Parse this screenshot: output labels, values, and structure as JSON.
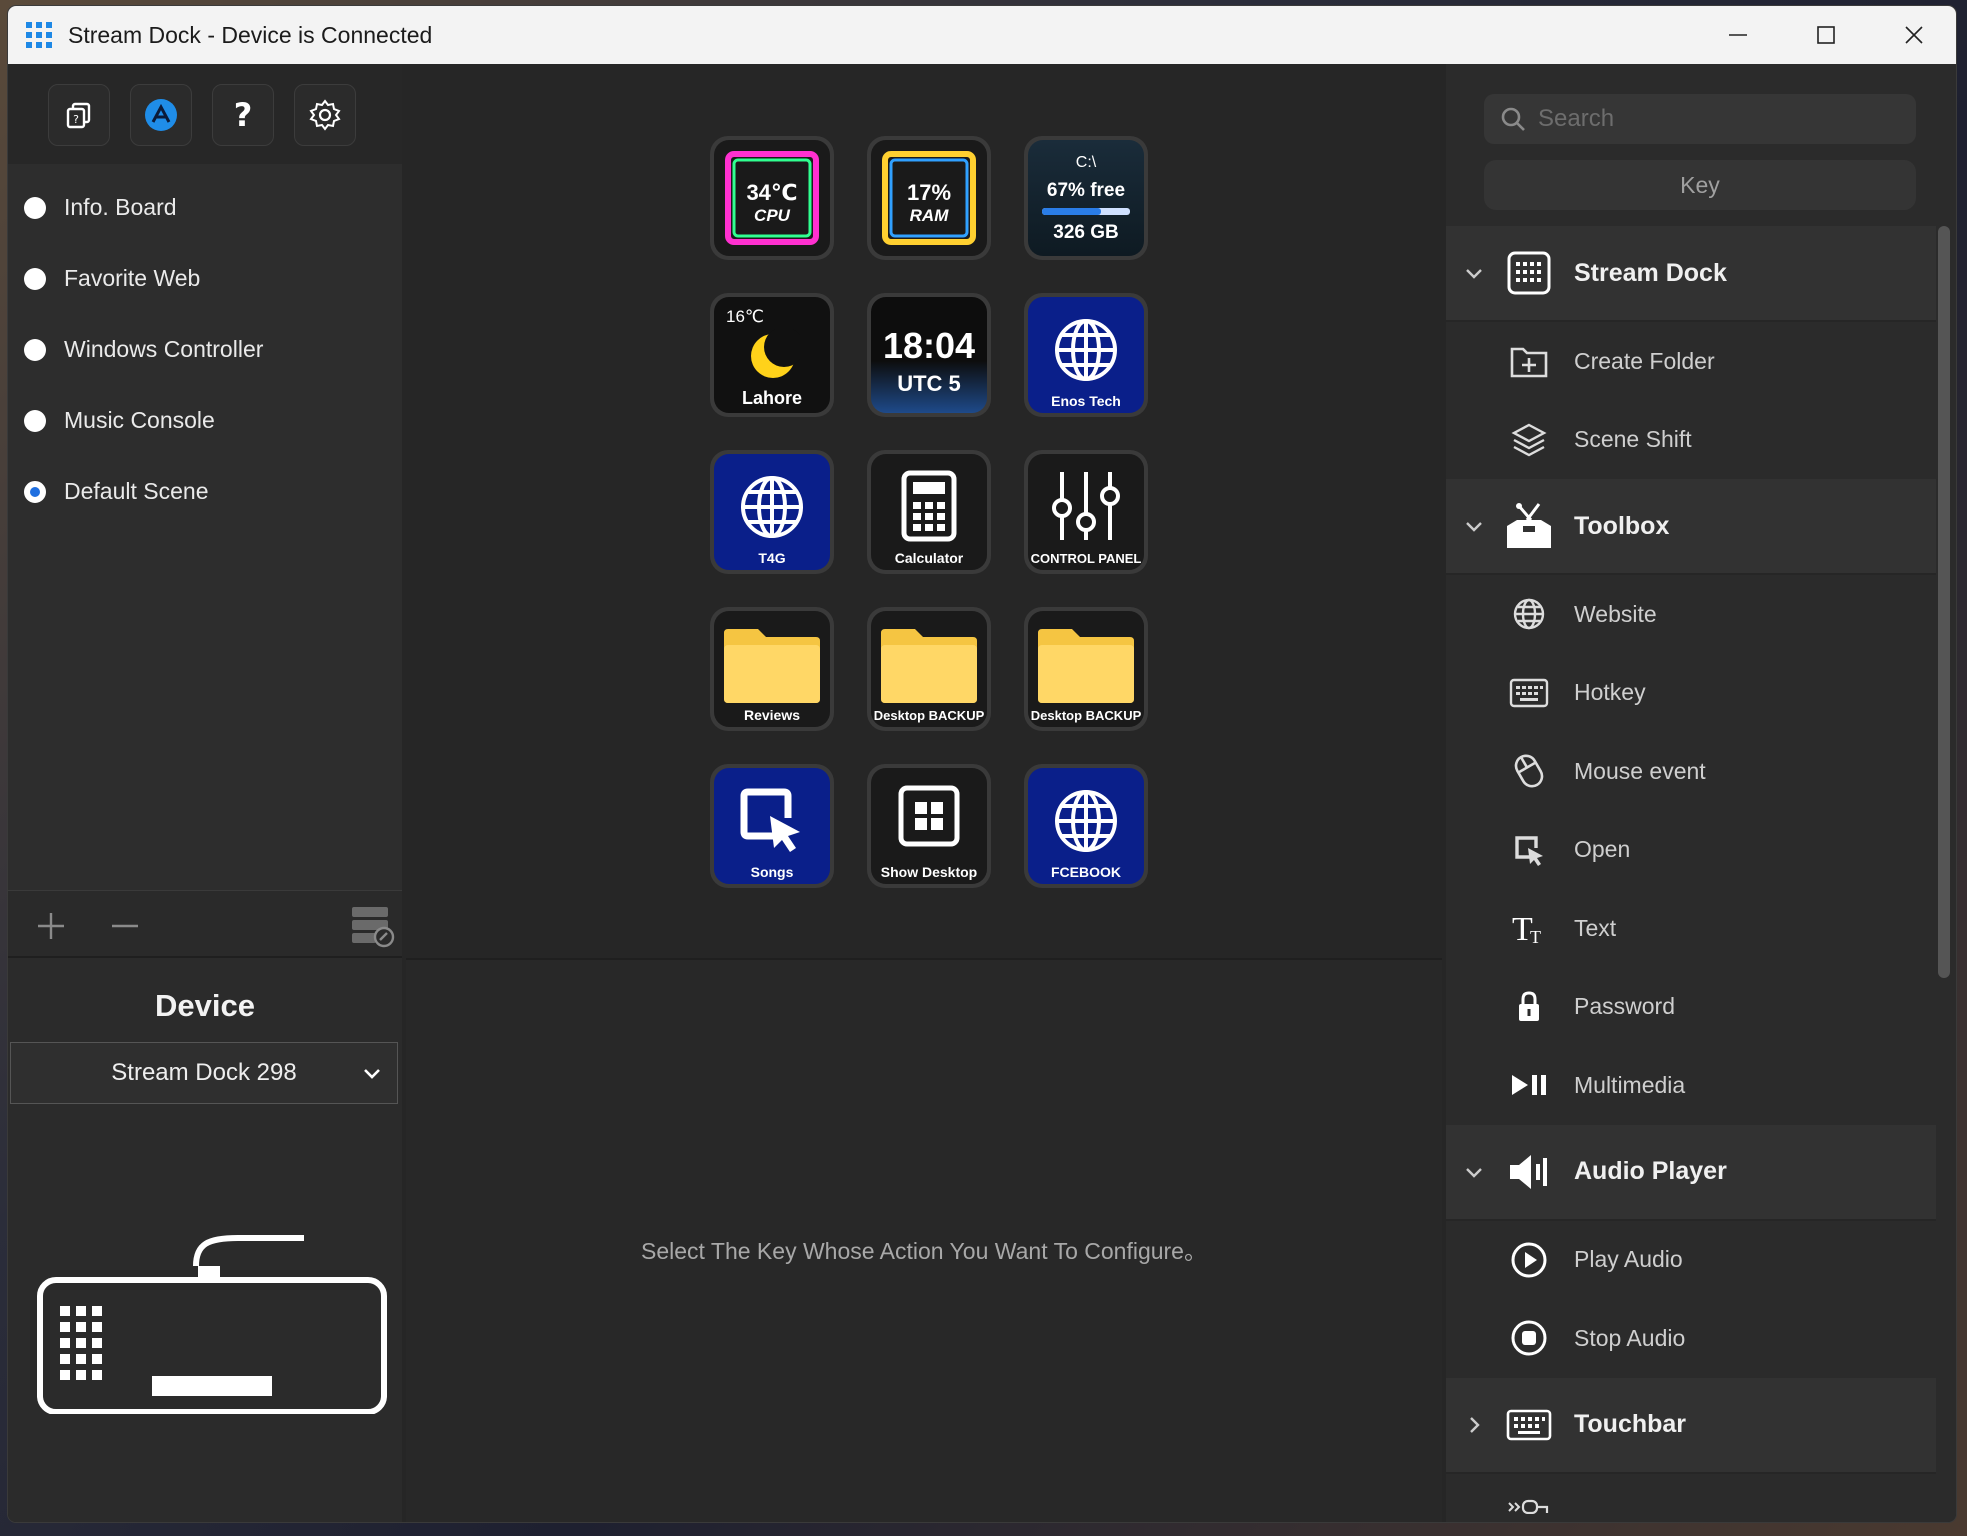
{
  "window": {
    "title": "Stream Dock - Device is Connected"
  },
  "scenes": [
    {
      "label": "Info. Board",
      "selected": false
    },
    {
      "label": "Favorite Web",
      "selected": false
    },
    {
      "label": "Windows Controller",
      "selected": false
    },
    {
      "label": "Music Console",
      "selected": false
    },
    {
      "label": "Default Scene",
      "selected": true
    }
  ],
  "device": {
    "title": "Device",
    "selected": "Stream Dock 298"
  },
  "keys": {
    "cpu": {
      "value": "34℃",
      "label": "CPU"
    },
    "ram": {
      "value": "17%",
      "label": "RAM"
    },
    "disk": {
      "drive": "C:\\",
      "free": "67% free",
      "size": "326 GB"
    },
    "weather": {
      "temp": "16℃",
      "city": "Lahore"
    },
    "clock": {
      "time": "18:04",
      "zone": "UTC 5"
    },
    "enos": {
      "label": "Enos Tech"
    },
    "t4g": {
      "label": "T4G"
    },
    "calculator": {
      "label": "Calculator"
    },
    "control_panel": {
      "label": "CONTROL PANEL"
    },
    "reviews": {
      "label": "Reviews"
    },
    "desktop_backup_1": {
      "label": "Desktop BACKUP"
    },
    "desktop_backup_2": {
      "label": "Desktop BACKUP"
    },
    "songs": {
      "label": "Songs"
    },
    "show_desktop": {
      "label": "Show Desktop"
    },
    "facebook": {
      "label": "FCEBOOK"
    }
  },
  "hint": "Select The Key Whose Action You Want To Configure。",
  "right": {
    "search_placeholder": "Search",
    "key_button": "Key",
    "categories": {
      "stream_dock": {
        "label": "Stream Dock",
        "actions": [
          "Create Folder",
          "Scene Shift"
        ]
      },
      "toolbox": {
        "label": "Toolbox",
        "actions": [
          "Website",
          "Hotkey",
          "Mouse event",
          "Open",
          "Text",
          "Password",
          "Multimedia"
        ]
      },
      "audio_player": {
        "label": "Audio Player",
        "actions": [
          "Play Audio",
          "Stop Audio"
        ]
      },
      "touchbar": {
        "label": "Touchbar"
      }
    }
  },
  "colors": {
    "accent": "#1f6fe0",
    "key_blue": "#0a1f8a",
    "folder_yellow": "#f5c542"
  }
}
